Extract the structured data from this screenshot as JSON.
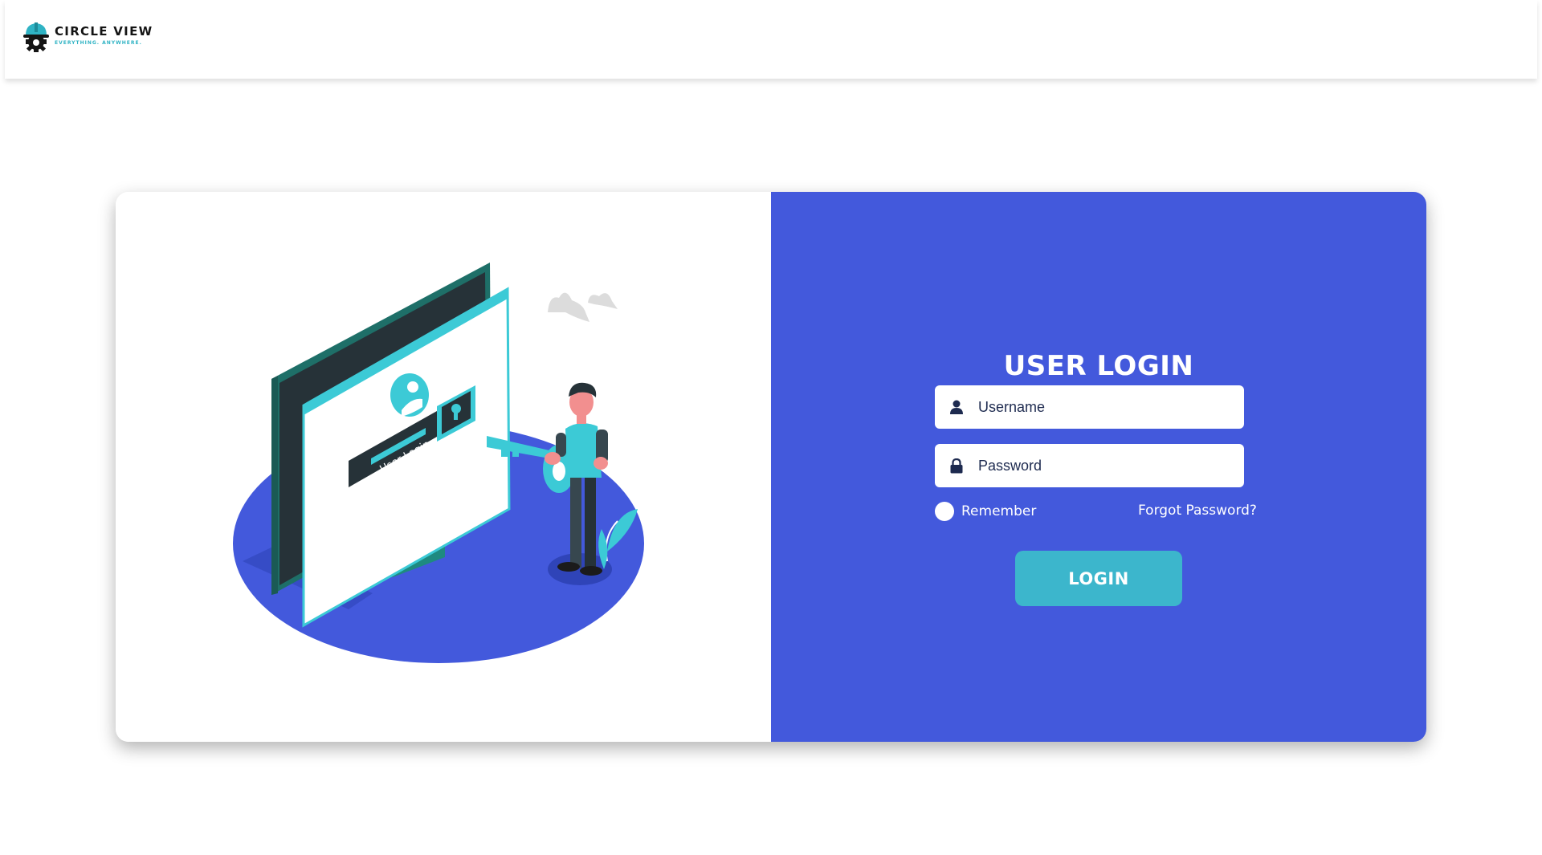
{
  "brand": {
    "name": "CIRCLE VIEW",
    "tagline": "EVERYTHING. ANYWHERE."
  },
  "illustration": {
    "screen_label": "User Login"
  },
  "login": {
    "title": "USER LOGIN",
    "username_placeholder": "Username",
    "password_placeholder": "Password",
    "remember_label": "Remember",
    "forgot_label": "Forgot Password?",
    "button_label": "LOGIN"
  },
  "colors": {
    "panel": "#4359dc",
    "button": "#3cb6cc",
    "accent": "#2fb3c4"
  },
  "icons": {
    "username": "user-icon",
    "password": "lock-icon",
    "logo": "helmet-gear-icon"
  }
}
